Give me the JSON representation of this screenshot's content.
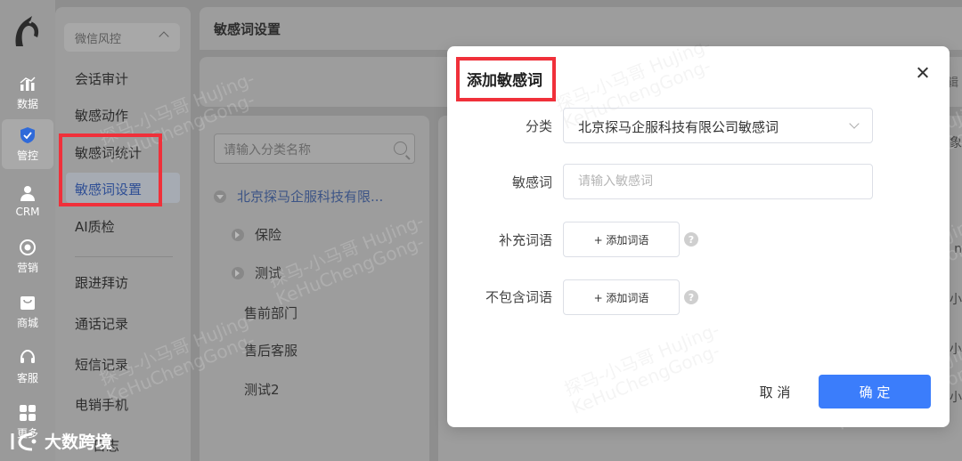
{
  "rail": {
    "items": [
      {
        "label": "数据",
        "icon": "bar-chart-icon"
      },
      {
        "label": "管控",
        "icon": "shield-icon"
      },
      {
        "label": "CRM",
        "icon": "user-icon"
      },
      {
        "label": "营销",
        "icon": "target-icon"
      },
      {
        "label": "商城",
        "icon": "shop-icon"
      },
      {
        "label": "客服",
        "icon": "headset-icon"
      },
      {
        "label": "更多",
        "icon": "grid-icon"
      }
    ]
  },
  "submenu": {
    "group": "微信风控",
    "items": [
      "会话审计",
      "敏感动作",
      "敏感词统计",
      "敏感词设置",
      "AI质检"
    ],
    "items2": [
      "跟进拜访",
      "通话记录",
      "短信记录",
      "电销手机",
      "日志"
    ]
  },
  "header": {
    "title": "敏感词设置"
  },
  "toolbar": {
    "edge_text": "编辑"
  },
  "tree": {
    "search_placeholder": "请输入分类名称",
    "root": "北京探马企服科技有限...",
    "children": [
      "保险",
      "测试"
    ],
    "leaves": [
      "售前部门",
      "售后客服",
      "测试2"
    ]
  },
  "right_edge": [
    "对象",
    "n",
    "小",
    "小",
    "小"
  ],
  "watermark": {
    "line1": "探马-小马哥 HuJing-",
    "line2": "KeHuChengGong-"
  },
  "brand": {
    "text": "大数跨境"
  },
  "modal": {
    "title": "添加敏感词",
    "fields": {
      "category": {
        "label": "分类",
        "value": "北京探马企服科技有限公司敏感词"
      },
      "word": {
        "label": "敏感词",
        "placeholder": "请输入敏感词"
      },
      "supplement": {
        "label": "补充词语",
        "button": "+ 添加词语"
      },
      "exclude": {
        "label": "不包含词语",
        "button": "+ 添加词语"
      }
    },
    "help_glyph": "?",
    "cancel": "取 消",
    "confirm": "确 定"
  },
  "colors": {
    "primary": "#3b7dfb",
    "highlight": "#f0303a",
    "overlay": "#8e8e8e"
  }
}
